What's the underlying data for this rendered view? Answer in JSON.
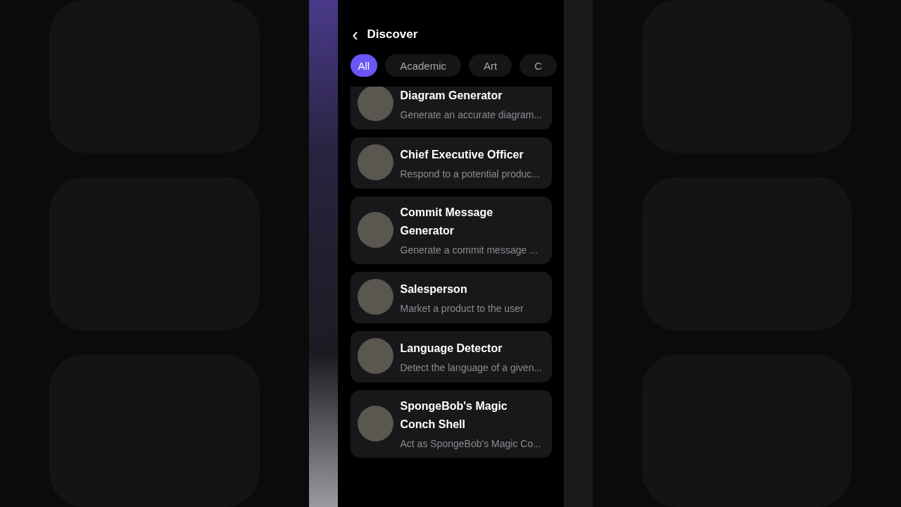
{
  "header": {
    "back_icon": "‹",
    "title": "Discover"
  },
  "categories": [
    {
      "label": "All",
      "selected": true
    },
    {
      "label": "Academic",
      "selected": false
    },
    {
      "label": "Art",
      "selected": false
    },
    {
      "label": "C",
      "selected": false
    }
  ],
  "bots": [
    {
      "name": "Diagram Generator",
      "description": "Generate an accurate diagram..."
    },
    {
      "name": "Chief Executive Officer",
      "description": "Respond to a potential produc..."
    },
    {
      "name": "Commit Message Generator",
      "description": "Generate a commit message ..."
    },
    {
      "name": "Salesperson",
      "description": "Market a product to the user"
    },
    {
      "name": "Language Detector",
      "description": "Detect the language of a given..."
    },
    {
      "name": "SpongeBob's Magic Conch Shell",
      "description": "Act as SpongeBob's Magic Co..."
    }
  ]
}
